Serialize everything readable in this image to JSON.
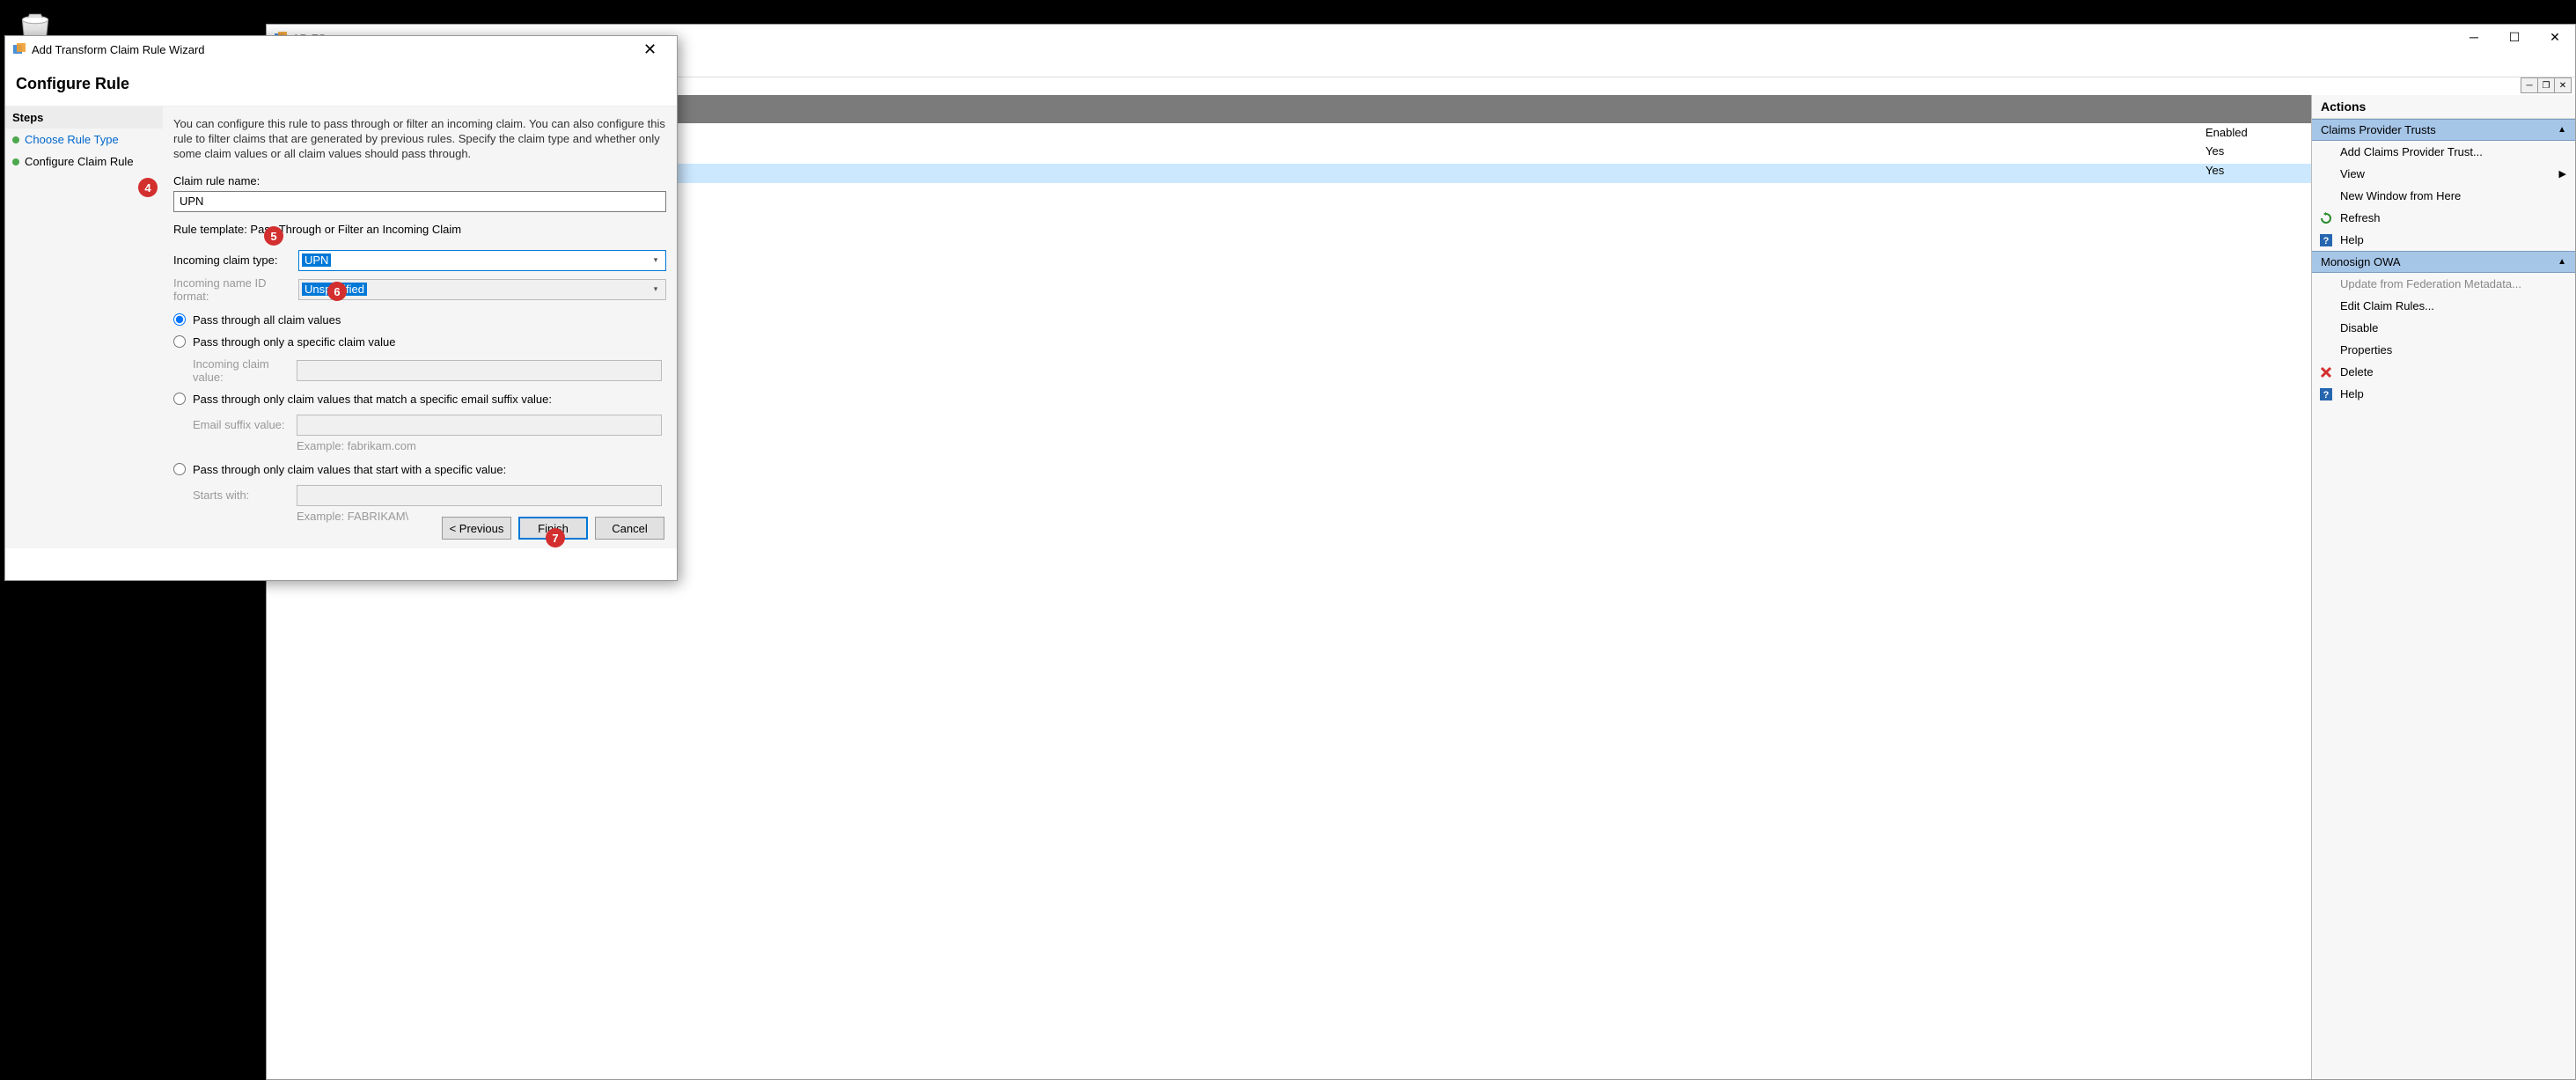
{
  "desktop": {
    "recycle_bin": "Recycle Bin"
  },
  "adfs": {
    "title": "AD FS",
    "table": {
      "header_enabled": "Enabled",
      "rows": [
        {
          "enabled": "Yes"
        },
        {
          "enabled": "Yes"
        }
      ]
    }
  },
  "actions": {
    "title": "Actions",
    "section1": {
      "title": "Claims Provider Trusts",
      "items": {
        "add": "Add Claims Provider Trust...",
        "view": "View",
        "new_window": "New Window from Here",
        "refresh": "Refresh",
        "help": "Help"
      }
    },
    "section2": {
      "title": "Monosign OWA",
      "items": {
        "update": "Update from Federation Metadata...",
        "edit": "Edit Claim Rules...",
        "disable": "Disable",
        "properties": "Properties",
        "delete": "Delete",
        "help": "Help"
      }
    }
  },
  "wizard": {
    "title": "Add Transform Claim Rule Wizard",
    "header": "Configure Rule",
    "steps_header": "Steps",
    "steps": [
      "Choose Rule Type",
      "Configure Claim Rule"
    ],
    "description": "You can configure this rule to pass through or filter an incoming claim. You can also configure this rule to filter claims that are generated by previous rules. Specify the claim type and whether only some claim values or all claim values should pass through.",
    "claim_rule_name_label": "Claim rule name:",
    "claim_rule_name_value": "UPN",
    "rule_template_label": "Rule template: Pass Through or Filter an Incoming Claim",
    "incoming_type_label": "Incoming claim type:",
    "incoming_type_value": "UPN",
    "name_id_label": "Incoming name ID format:",
    "name_id_value": "Unspecified",
    "radio_all": "Pass through all claim values",
    "radio_specific": "Pass through only a specific claim value",
    "incoming_value_label": "Incoming claim value:",
    "radio_email": "Pass through only claim values that match a specific email suffix value:",
    "email_suffix_label": "Email suffix value:",
    "email_example": "Example: fabrikam.com",
    "radio_starts": "Pass through only claim values that start with a specific value:",
    "starts_label": "Starts with:",
    "starts_example": "Example: FABRIKAM\\",
    "buttons": {
      "previous": "< Previous",
      "finish": "Finish",
      "cancel": "Cancel"
    }
  },
  "callouts": {
    "c4": "4",
    "c5": "5",
    "c6": "6",
    "c7": "7"
  }
}
